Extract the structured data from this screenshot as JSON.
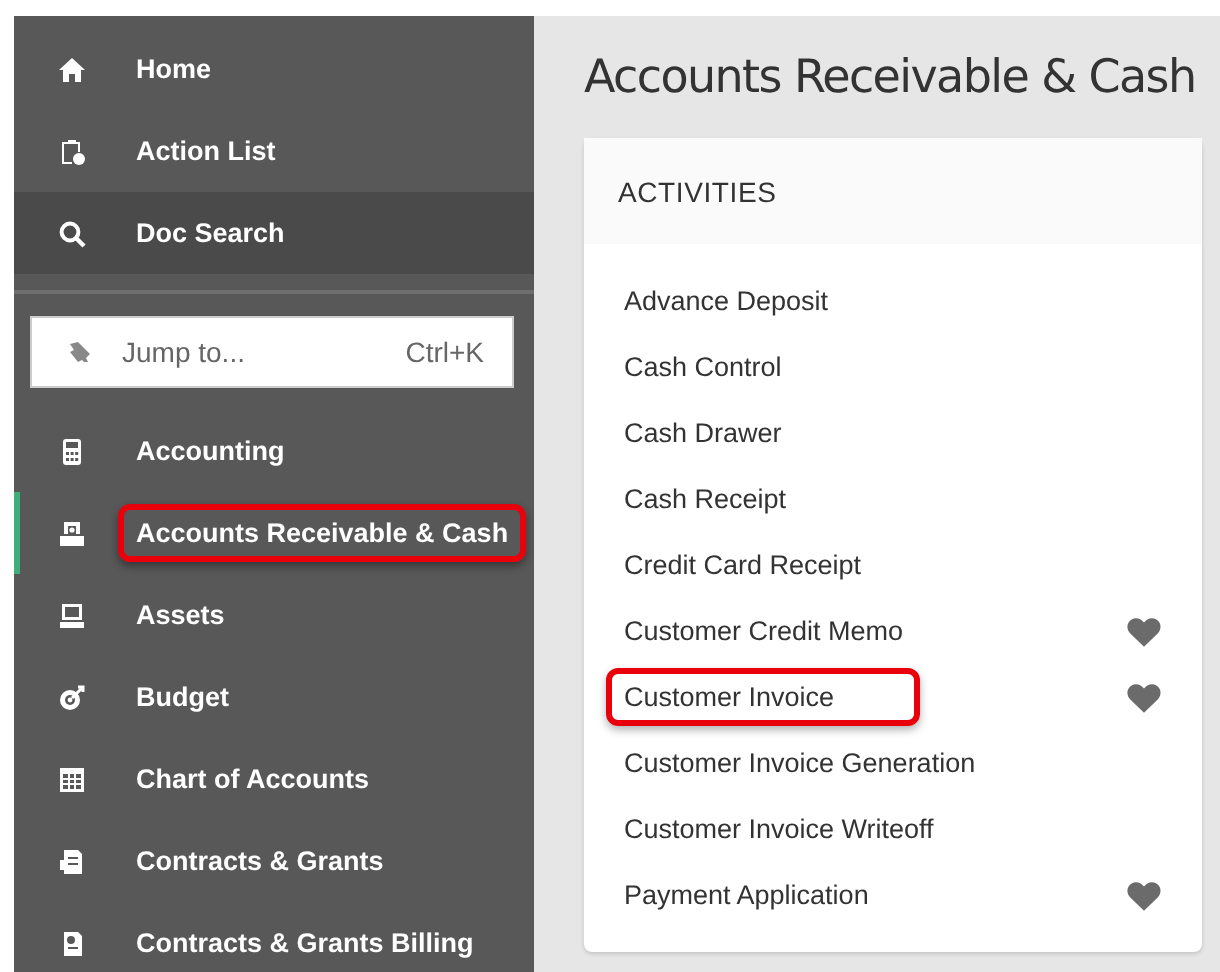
{
  "sidebar": {
    "top_items": [
      {
        "label": "Home",
        "selected": false
      },
      {
        "label": "Action List",
        "selected": false
      },
      {
        "label": "Doc Search",
        "selected": true
      }
    ],
    "jump": {
      "placeholder": "Jump to...",
      "shortcut": "Ctrl+K"
    },
    "modules": [
      {
        "label": "Accounting",
        "selected": false,
        "highlighted": false
      },
      {
        "label": "Accounts Receivable & Cash",
        "selected": true,
        "highlighted": true
      },
      {
        "label": "Assets",
        "selected": false,
        "highlighted": false
      },
      {
        "label": "Budget",
        "selected": false,
        "highlighted": false
      },
      {
        "label": "Chart of Accounts",
        "selected": false,
        "highlighted": false
      },
      {
        "label": "Contracts & Grants",
        "selected": false,
        "highlighted": false
      },
      {
        "label": "Contracts & Grants Billing",
        "selected": false,
        "highlighted": false
      }
    ]
  },
  "page_title": "Accounts Receivable & Cash",
  "activities": {
    "heading": "ACTIVITIES",
    "items": [
      {
        "label": "Advance Deposit",
        "favorite": false,
        "highlighted": false
      },
      {
        "label": "Cash Control",
        "favorite": false,
        "highlighted": false
      },
      {
        "label": "Cash Drawer",
        "favorite": false,
        "highlighted": false
      },
      {
        "label": "Cash Receipt",
        "favorite": false,
        "highlighted": false
      },
      {
        "label": "Credit Card Receipt",
        "favorite": false,
        "highlighted": false
      },
      {
        "label": "Customer Credit Memo",
        "favorite": true,
        "highlighted": false
      },
      {
        "label": "Customer Invoice",
        "favorite": true,
        "highlighted": true
      },
      {
        "label": "Customer Invoice Generation",
        "favorite": false,
        "highlighted": false
      },
      {
        "label": "Customer Invoice Writeoff",
        "favorite": false,
        "highlighted": false
      },
      {
        "label": "Payment Application",
        "favorite": true,
        "highlighted": false
      }
    ]
  }
}
